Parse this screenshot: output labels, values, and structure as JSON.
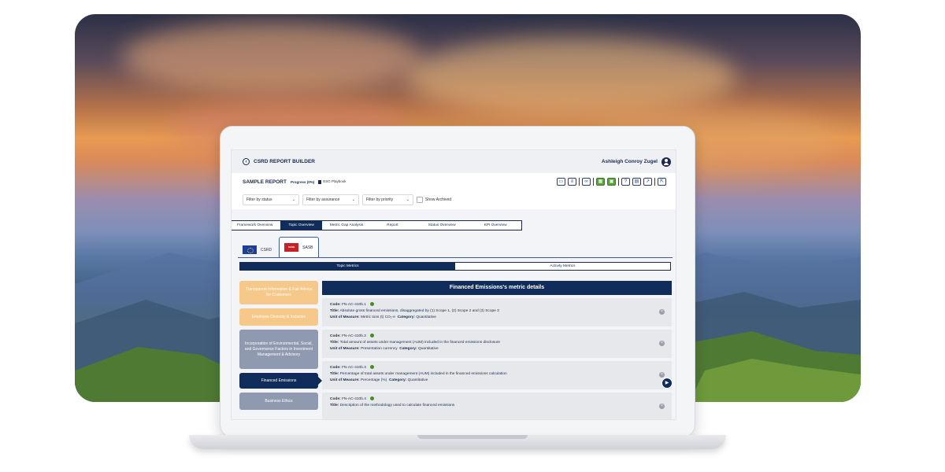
{
  "app": {
    "title": "CSRD REPORT BUILDER",
    "user": "Ashleigh Conroy Zugel"
  },
  "report": {
    "name": "SAMPLE REPORT",
    "progress": "Progress (0%)",
    "playbook": "ESG Playbook"
  },
  "filters": {
    "status": "Filter by status",
    "assurance": "Filter by assurance",
    "priority": "Filter by priority",
    "show_archived": "Show Archived"
  },
  "tabs": [
    "Framework Overview",
    "Topic Overview",
    "Metric Gap Analysis",
    "Report",
    "Status Overview",
    "KPI Overview"
  ],
  "frameworks": [
    "CSRD",
    "SASB"
  ],
  "metric_tabs": [
    "Topic Metrics",
    "Activity Metrics"
  ],
  "sidebar": [
    "Transparent Information & Fair Advice for Customers",
    "Employee Diversity & Inclusion",
    "Incorporation of Environmental, Social, and Governance Factors in Investment Management & Advisory",
    "Financed Emissions",
    "Business Ethics"
  ],
  "detail": {
    "heading": "Financed Emissions's metric details",
    "code_label": "Code:",
    "title_label": "Title:",
    "unit_label": "Unit of Measure:",
    "category_label": "Category:",
    "metrics": [
      {
        "code": "FN-AC-410b.1",
        "title": "Absolute gross financed emissions, disaggregated by (1) Scope 1, (2) Scope 2 and (3) Scope 3",
        "unit": "Metric tons (t) CO₂-e",
        "category": "Quantitative"
      },
      {
        "code": "FN-AC-410b.2",
        "title": "Total amount of assets under management (AUM) included in the financed emissions disclosure",
        "unit": "Presentation currency",
        "category": "Quantitative"
      },
      {
        "code": "FN-AC-410b.3",
        "title": "Percentage of total assets under management (AUM) included in the financed emissions calculation",
        "unit": "Percentage (%)",
        "category": "Quantitative"
      },
      {
        "code": "FN-AC-410b.4",
        "title": "Description of the methodology used to calculate financed emissions",
        "unit": "",
        "category": ""
      }
    ]
  },
  "colors": {
    "navy": "#0f2c5a",
    "sidebar_yellow": "#f6c88a",
    "sidebar_gray": "#8f9ab0",
    "accent_green": "#5aa23a"
  }
}
